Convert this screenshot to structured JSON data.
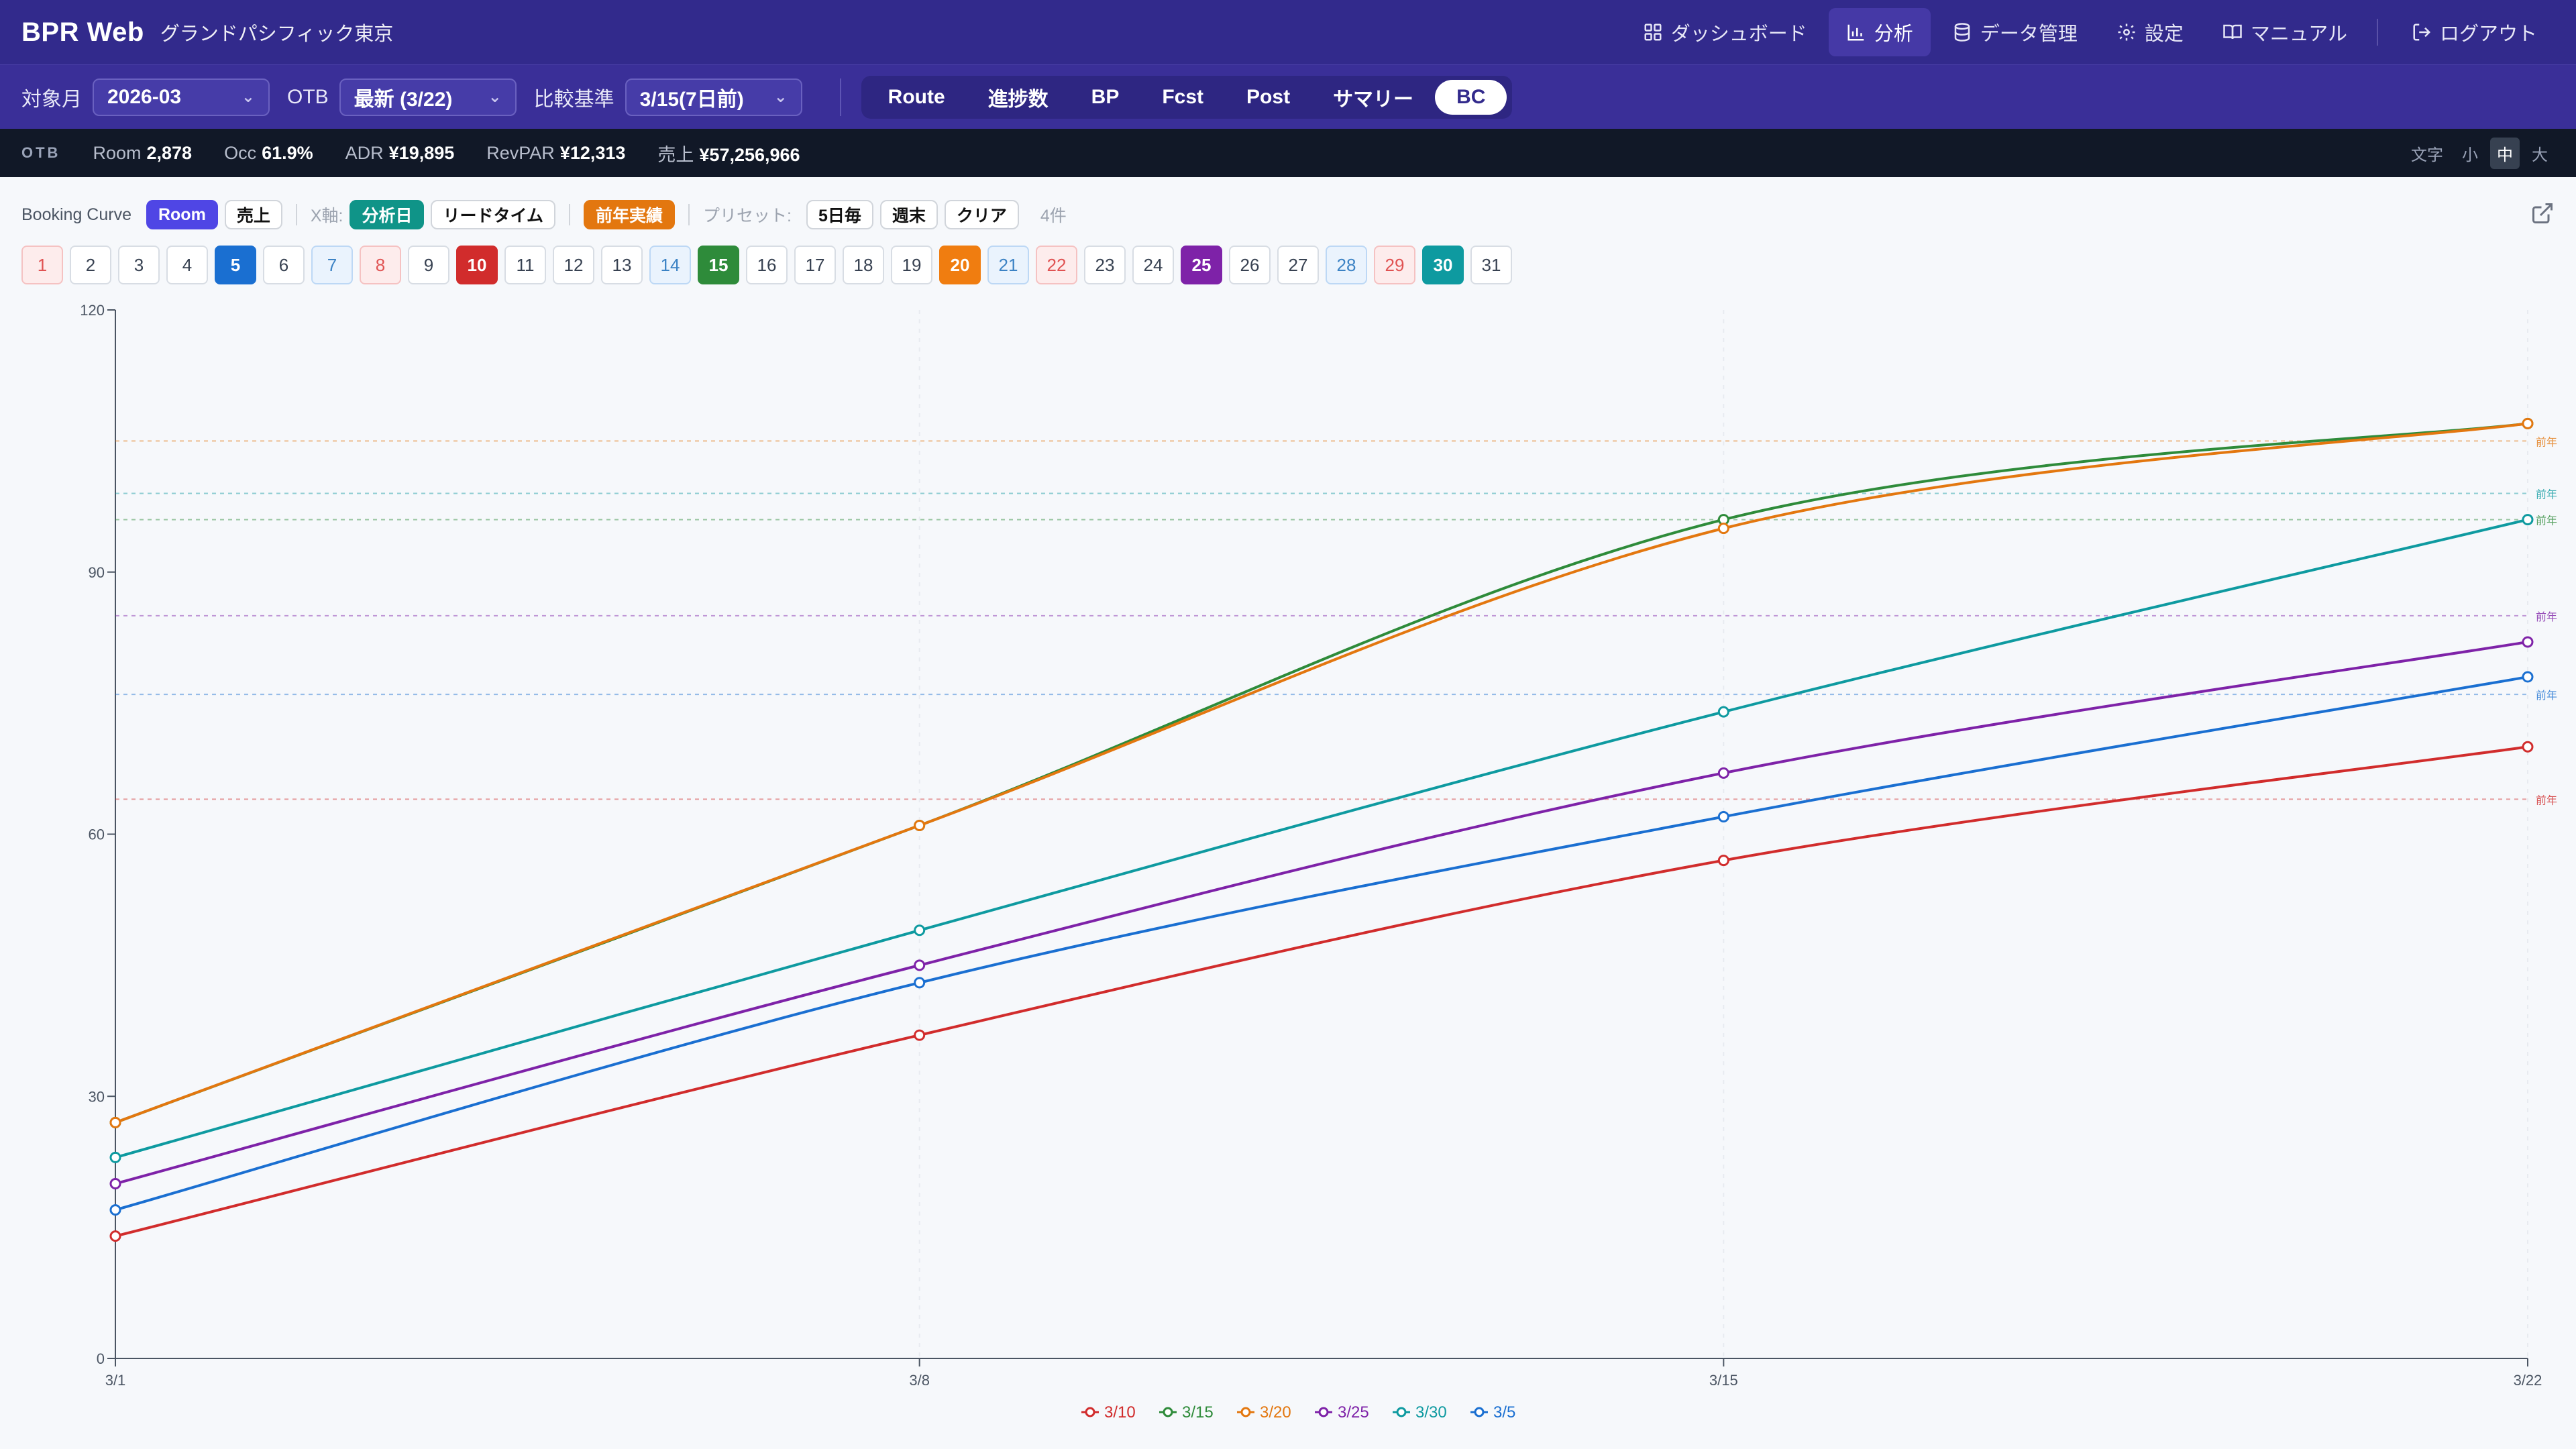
{
  "app": {
    "brand": "BPR Web",
    "hotel": "グランドパシフィック東京",
    "nav": [
      {
        "label": "ダッシュボード",
        "icon": "dashboard-icon"
      },
      {
        "label": "分析",
        "icon": "bar-chart-icon",
        "active": true
      },
      {
        "label": "データ管理",
        "icon": "database-icon"
      },
      {
        "label": "設定",
        "icon": "gear-icon"
      },
      {
        "label": "マニュアル",
        "icon": "book-icon"
      },
      {
        "label": "ログアウト",
        "icon": "logout-icon"
      }
    ]
  },
  "filters": {
    "month_label": "対象月",
    "month_value": "2026-03",
    "otb_label": "OTB",
    "otb_value": "最新 (3/22)",
    "compare_label": "比較基準",
    "compare_value": "3/15(7日前)"
  },
  "tabs": [
    "Route",
    "進捗数",
    "BP",
    "Fcst",
    "Post",
    "サマリー",
    "BC"
  ],
  "active_tab": "BC",
  "stats": {
    "otb_tag": "OTB",
    "room_label": "Room",
    "room_value": "2,878",
    "occ_label": "Occ",
    "occ_value": "61.9%",
    "adr_label": "ADR",
    "adr_value": "¥19,895",
    "revpar_label": "RevPAR",
    "revpar_value": "¥12,313",
    "sales_label": "売上",
    "sales_value": "¥57,256,966",
    "font_label": "文字",
    "font_sizes": [
      "小",
      "中",
      "大"
    ]
  },
  "controls": {
    "title": "Booking Curve",
    "room": "Room",
    "sales": "売上",
    "xaxis_label": "X軸:",
    "x_analysis": "分析日",
    "x_lead": "リードタイム",
    "prev_year": "前年実績",
    "preset_label": "プリセット:",
    "preset_5": "5日毎",
    "preset_weekend": "週末",
    "preset_clear": "クリア",
    "count": "4件"
  },
  "days": [
    {
      "n": "1",
      "kind": "sun"
    },
    {
      "n": "2"
    },
    {
      "n": "3"
    },
    {
      "n": "4"
    },
    {
      "n": "5",
      "sel": "#1a6fd1"
    },
    {
      "n": "6"
    },
    {
      "n": "7",
      "kind": "sat"
    },
    {
      "n": "8",
      "kind": "sun"
    },
    {
      "n": "9"
    },
    {
      "n": "10",
      "sel": "#d12c2c"
    },
    {
      "n": "11"
    },
    {
      "n": "12"
    },
    {
      "n": "13"
    },
    {
      "n": "14",
      "kind": "sat"
    },
    {
      "n": "15",
      "sel": "#2e8b3a"
    },
    {
      "n": "16"
    },
    {
      "n": "17"
    },
    {
      "n": "18"
    },
    {
      "n": "19"
    },
    {
      "n": "20",
      "sel": "#f07d10"
    },
    {
      "n": "21",
      "kind": "sat"
    },
    {
      "n": "22",
      "kind": "sun"
    },
    {
      "n": "23"
    },
    {
      "n": "24"
    },
    {
      "n": "25",
      "sel": "#7e22a8"
    },
    {
      "n": "26"
    },
    {
      "n": "27"
    },
    {
      "n": "28",
      "kind": "sat"
    },
    {
      "n": "29",
      "kind": "sun"
    },
    {
      "n": "30",
      "sel": "#0e9aa0"
    },
    {
      "n": "31"
    }
  ],
  "chart_data": {
    "type": "line",
    "x": [
      "3/1",
      "3/8",
      "3/15",
      "3/22"
    ],
    "ylim": [
      0,
      120
    ],
    "yticks": [
      0,
      30,
      60,
      90,
      120
    ],
    "series": [
      {
        "name": "3/10",
        "color": "#d12c2c",
        "values": [
          14,
          37,
          57,
          70
        ],
        "ref": 64
      },
      {
        "name": "3/15",
        "color": "#2e8b3a",
        "values": [
          27,
          61,
          96,
          107
        ],
        "ref": 96
      },
      {
        "name": "3/20",
        "color": "#e3770f",
        "values": [
          27,
          61,
          95,
          107
        ],
        "ref": 105
      },
      {
        "name": "3/25",
        "color": "#7e22a8",
        "values": [
          20,
          45,
          67,
          82
        ],
        "ref": 85
      },
      {
        "name": "3/30",
        "color": "#0e9aa0",
        "values": [
          23,
          49,
          74,
          96
        ],
        "ref": 99
      },
      {
        "name": "3/5",
        "color": "#1a6fd1",
        "values": [
          17,
          43,
          62,
          78
        ],
        "ref": 76
      }
    ],
    "ref_label": "前年"
  }
}
